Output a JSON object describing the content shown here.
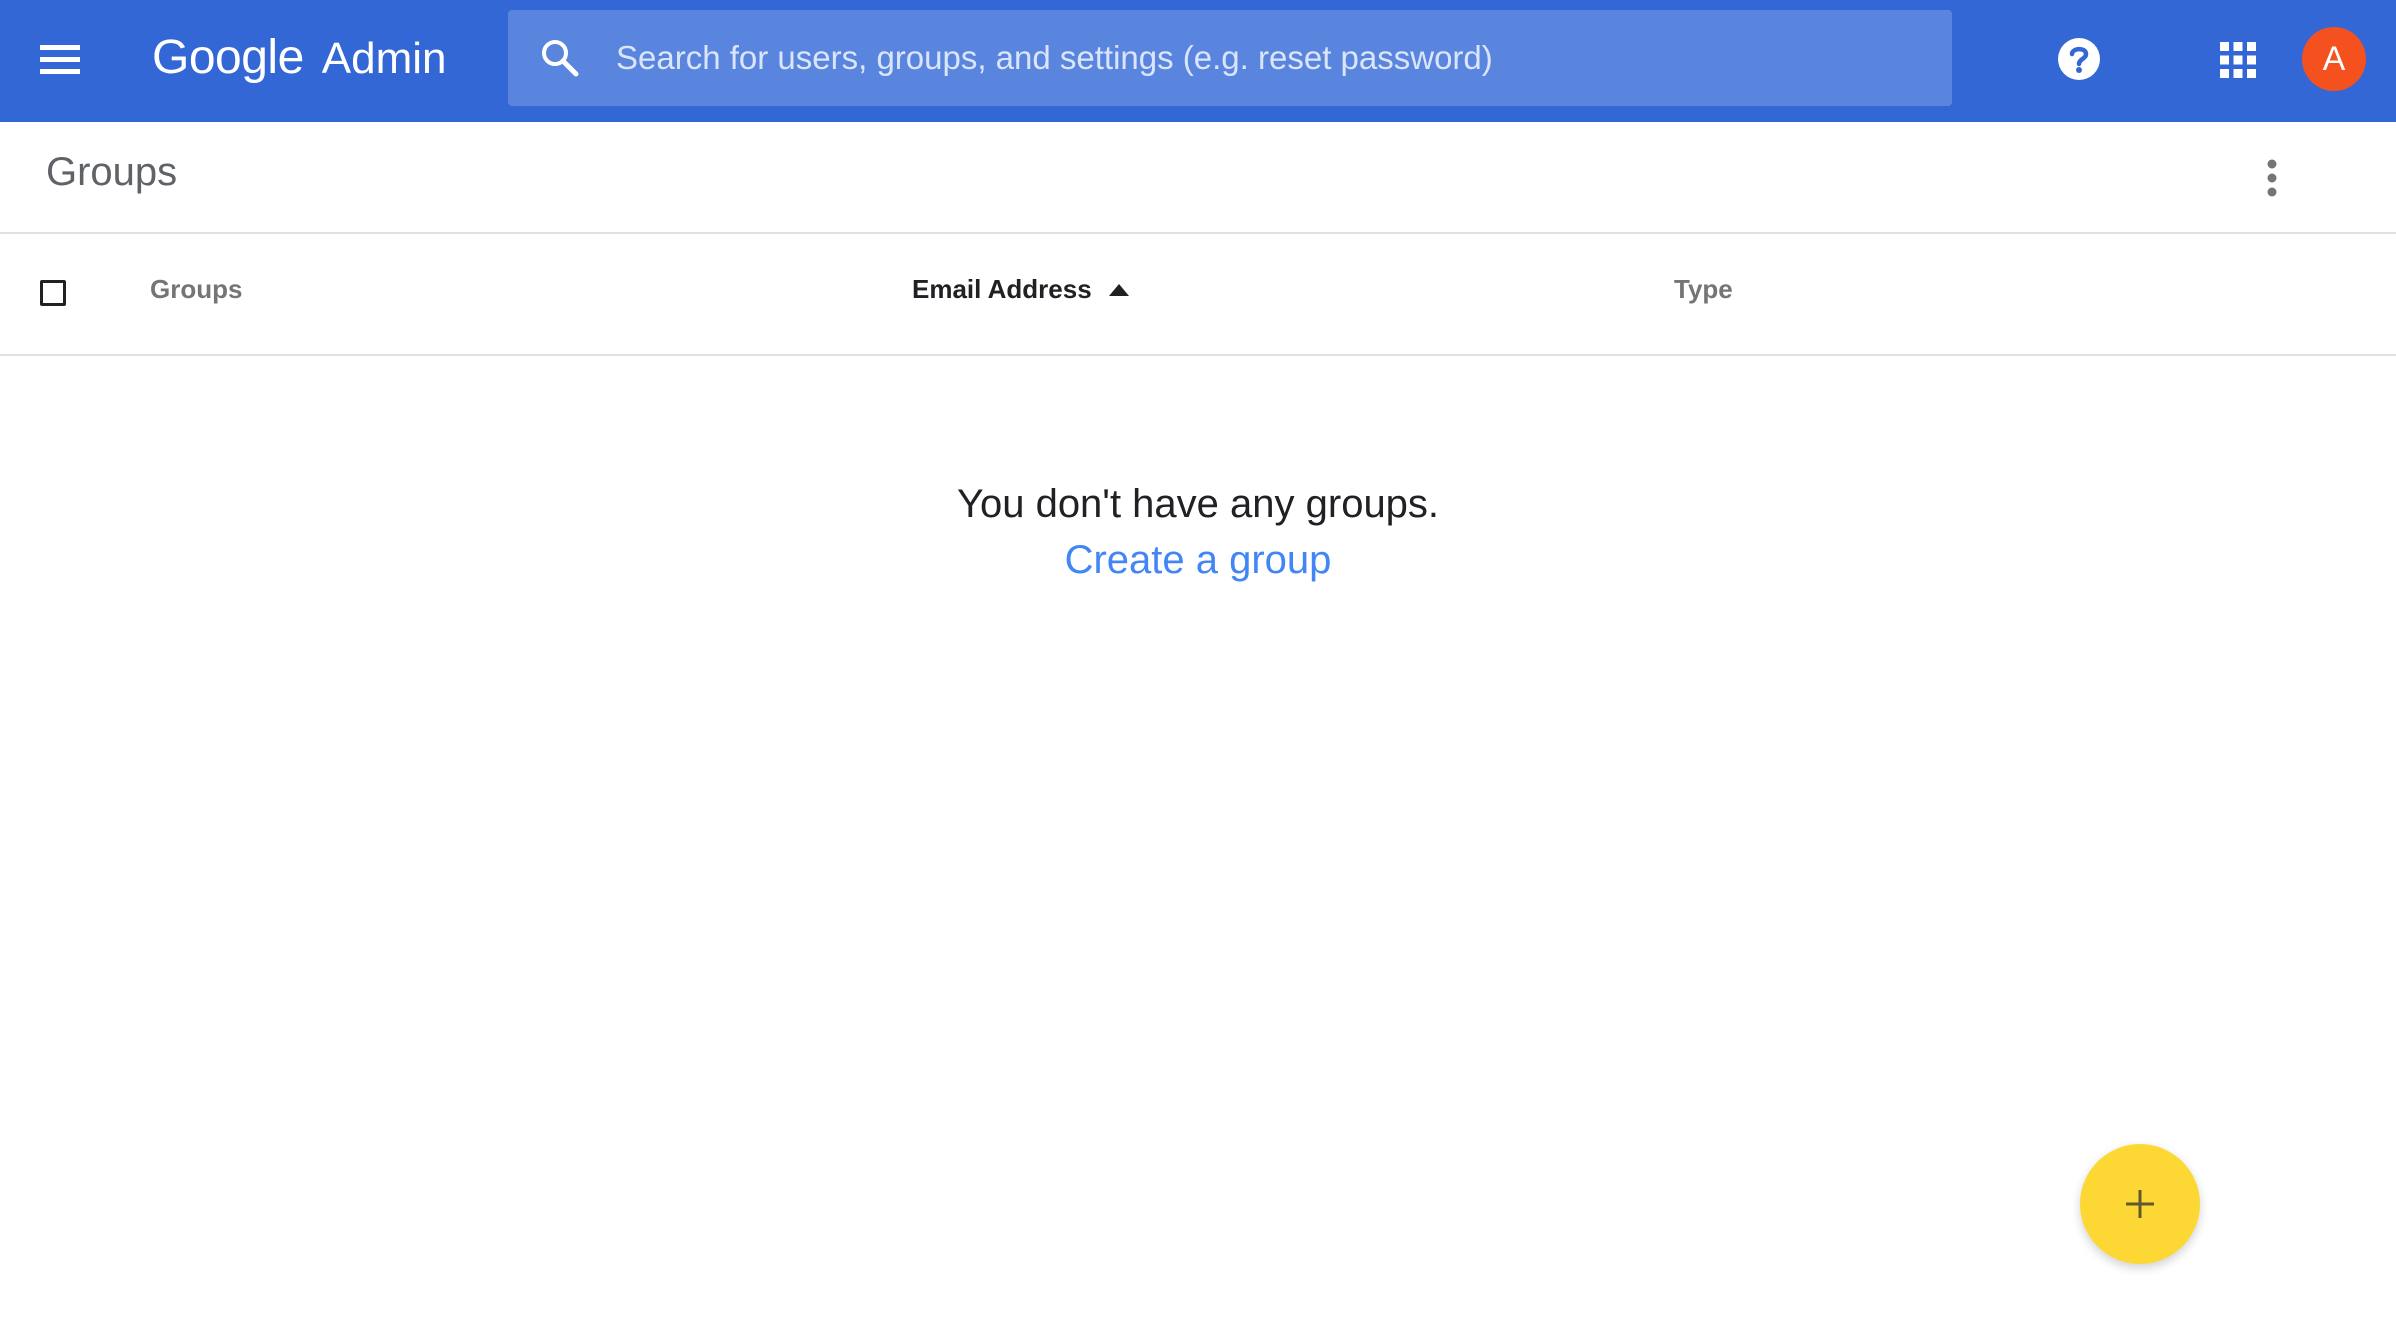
{
  "app": {
    "brand_google": "Google",
    "brand_product": "Admin"
  },
  "search": {
    "placeholder": "Search for users, groups, and settings (e.g. reset password)",
    "value": ""
  },
  "avatar": {
    "initial": "A",
    "color": "#f4511e"
  },
  "page": {
    "title": "Groups"
  },
  "table": {
    "columns": [
      {
        "label": "Groups",
        "sorted": false
      },
      {
        "label": "Email Address",
        "sorted": true,
        "sort_direction": "ascending"
      },
      {
        "label": "Type",
        "sorted": false
      }
    ],
    "select_all_checked": false
  },
  "empty_state": {
    "message": "You don't have any groups.",
    "link_label": "Create a group"
  },
  "icons": {
    "menu": "hamburger-menu-icon",
    "search": "search-icon",
    "help": "help-icon",
    "apps": "apps-grid-icon",
    "more": "more-vert-icon",
    "sort": "sort-ascending-icon",
    "fab": "add-icon"
  },
  "colors": {
    "topbar": "#3367d6",
    "search_bg": "#5a85df",
    "link": "#4285f4",
    "fab": "#fdd835"
  }
}
